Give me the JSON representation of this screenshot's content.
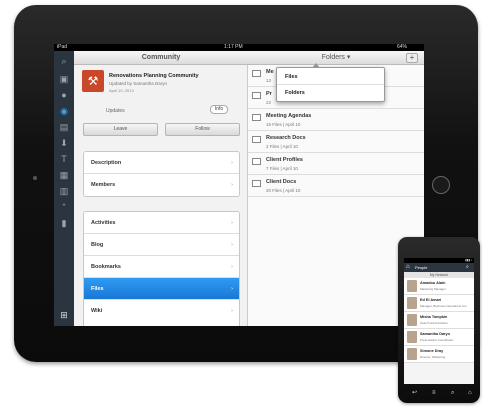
{
  "tablet": {
    "status": {
      "carrier": "iPad",
      "time": "1:17 PM",
      "battery": "64%"
    },
    "community": {
      "header": "Community",
      "name": "Renovations Planning Community",
      "updated_by": "Updated by Samantha Daryn",
      "date": "April 10, 2013",
      "tab_updates": "Updates",
      "tab_info": "Info",
      "leave": "Leave",
      "follow": "Follow",
      "group1": [
        {
          "label": "Description"
        },
        {
          "label": "Members"
        }
      ],
      "group2": [
        {
          "label": "Activities"
        },
        {
          "label": "Blog"
        },
        {
          "label": "Bookmarks"
        },
        {
          "label": "Files"
        },
        {
          "label": "Wiki"
        }
      ],
      "selected": "Files"
    },
    "folders": {
      "header": "Folders",
      "add": "+",
      "dropdown": [
        "Files",
        "Folders"
      ],
      "rows": [
        {
          "title": "Me",
          "sub": "13"
        },
        {
          "title": "Pr",
          "sub": "22"
        },
        {
          "title": "Meeting Agendas",
          "sub": "16 Files | April 10"
        },
        {
          "title": "Research Docs",
          "sub": "2 Files | April 10"
        },
        {
          "title": "Client Profiles",
          "sub": "7 Files | April 10"
        },
        {
          "title": "Client Docs",
          "sub": "20 Files | April 10"
        }
      ]
    }
  },
  "phone": {
    "title": "People",
    "subtitle": "My Network",
    "people": [
      {
        "name": "Amadou Alain",
        "role": "Marketing Manager"
      },
      {
        "name": "Ed El Amari",
        "role": "Manager, Business Operations Cor"
      },
      {
        "name": "Misha Tompkin",
        "role": "Search Administrator"
      },
      {
        "name": "Samantha Daryn",
        "role": "Presentation Coordinator"
      },
      {
        "name": "Simone Dray",
        "role": "Director, Marketing"
      }
    ]
  }
}
